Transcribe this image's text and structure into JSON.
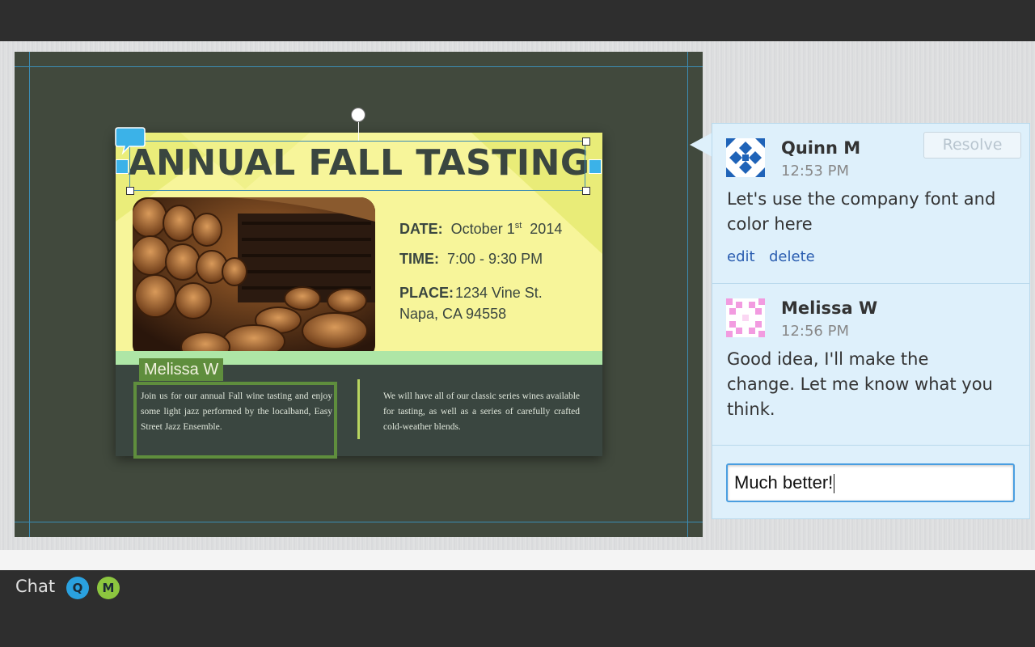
{
  "flyer": {
    "title": "ANNUAL FALL TASTING",
    "date_label": "DATE:",
    "date_value": "October 1",
    "date_suffix": "st",
    "date_year": "2014",
    "time_label": "TIME:",
    "time_value": "7:00 - 9:30 PM",
    "place_label": "PLACE:",
    "place_line1": "1234 Vine St.",
    "place_line2": "Napa, CA 94558",
    "body_left": "Join us for our annual Fall wine tasting and enjoy some light jazz performed by the localband, Easy Street Jazz Ensemble.",
    "body_right": "We will have all of our classic series wines available for tasting, as well as a series of carefully crafted cold-weather blends."
  },
  "collaborator_tag": "Melissa W",
  "comments": [
    {
      "author": "Quinn M",
      "time": "12:53 PM",
      "text": "Let's use the company font and color here",
      "edit_label": "edit",
      "delete_label": "delete"
    },
    {
      "author": "Melissa W",
      "time": "12:56 PM",
      "text": "Good idea, I'll make the change. Let me know what you think."
    }
  ],
  "resolve_label": "Resolve",
  "reply": {
    "value": "Much better!"
  },
  "chat": {
    "label": "Chat",
    "users": [
      {
        "initial": "Q",
        "color": "#2aa1df"
      },
      {
        "initial": "M",
        "color": "#8cc63f"
      }
    ]
  },
  "colors": {
    "canvas": "#41493d",
    "card": "#f7f59a",
    "accent_green": "#5f8e3d",
    "comment_panel": "#def0fb",
    "link": "#2a5db0"
  }
}
